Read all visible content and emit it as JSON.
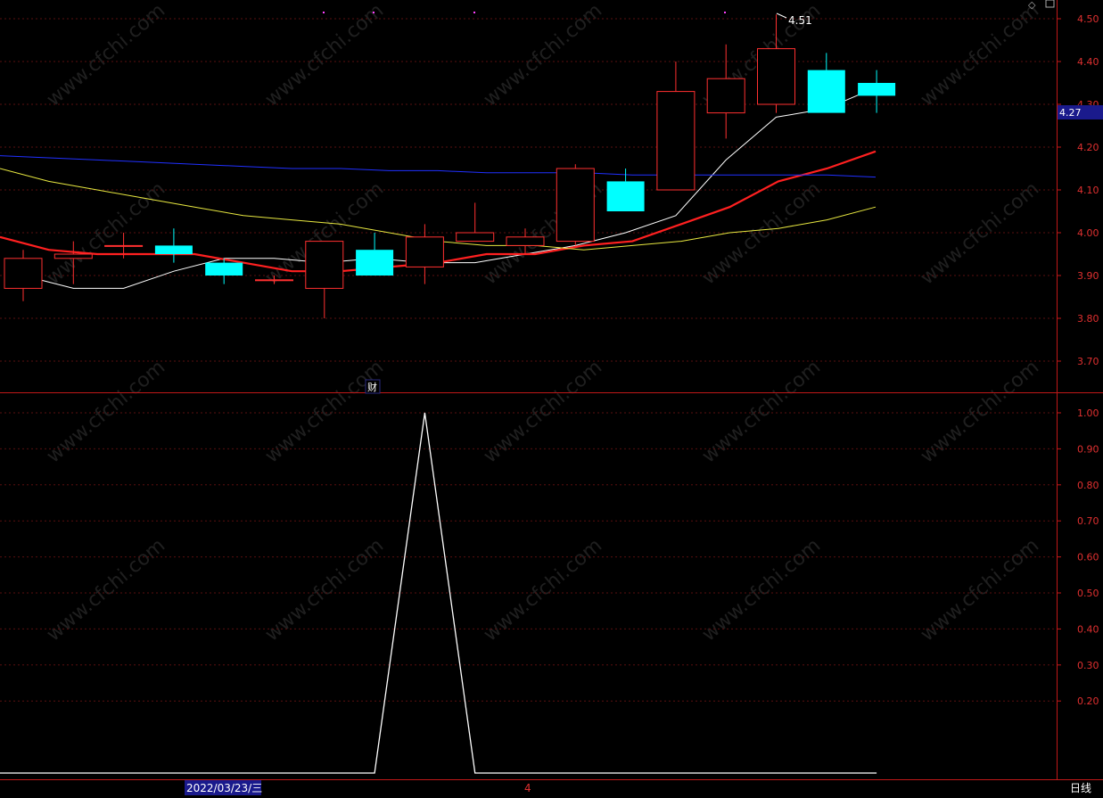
{
  "chart_data": [
    {
      "type": "candlestick",
      "panel": "price",
      "ylim": [
        3.65,
        4.53
      ],
      "y_ticks": [
        "4.50",
        "4.40",
        "4.30",
        "4.20",
        "4.10",
        "4.00",
        "3.90",
        "3.80",
        "3.70"
      ],
      "current_price_label": "4.27",
      "max_label": "4.51",
      "candles": [
        {
          "open": 3.87,
          "close": 3.94,
          "high": 3.96,
          "low": 3.84
        },
        {
          "open": 3.94,
          "close": 3.95,
          "high": 3.98,
          "low": 3.88
        },
        {
          "open": 3.97,
          "close": 3.97,
          "high": 4.0,
          "low": 3.94
        },
        {
          "open": 3.97,
          "close": 3.95,
          "high": 4.01,
          "low": 3.93
        },
        {
          "open": 3.93,
          "close": 3.9,
          "high": 3.94,
          "low": 3.88
        },
        {
          "open": 3.89,
          "close": 3.89,
          "high": 3.9,
          "low": 3.88
        },
        {
          "open": 3.87,
          "close": 3.98,
          "high": 3.98,
          "low": 3.8
        },
        {
          "open": 3.96,
          "close": 3.9,
          "high": 4.0,
          "low": 3.9
        },
        {
          "open": 3.92,
          "close": 3.99,
          "high": 4.02,
          "low": 3.88
        },
        {
          "open": 3.98,
          "close": 4.0,
          "high": 4.07,
          "low": 3.98
        },
        {
          "open": 3.97,
          "close": 3.99,
          "high": 4.01,
          "low": 3.95
        },
        {
          "open": 3.98,
          "close": 4.15,
          "high": 4.16,
          "low": 3.97
        },
        {
          "open": 4.12,
          "close": 4.05,
          "high": 4.15,
          "low": 4.05
        },
        {
          "open": 4.1,
          "close": 4.33,
          "high": 4.4,
          "low": 4.1
        },
        {
          "open": 4.28,
          "close": 4.36,
          "high": 4.44,
          "low": 4.22
        },
        {
          "open": 4.3,
          "close": 4.43,
          "high": 4.51,
          "low": 4.28
        },
        {
          "open": 4.38,
          "close": 4.28,
          "high": 4.42,
          "low": 4.28
        },
        {
          "open": 4.35,
          "close": 4.32,
          "high": 4.38,
          "low": 4.28
        }
      ],
      "series": [
        {
          "color": "#ffffff",
          "values": [
            3.9,
            3.87,
            3.87,
            3.91,
            3.94,
            3.94,
            3.93,
            3.94,
            3.93,
            3.93,
            3.95,
            3.97,
            4.0,
            4.04,
            4.17,
            4.27,
            4.29,
            4.34
          ]
        },
        {
          "color": "#ff2020",
          "values": [
            3.99,
            3.96,
            3.95,
            3.95,
            3.95,
            3.93,
            3.91,
            3.91,
            3.92,
            3.93,
            3.95,
            3.95,
            3.97,
            3.98,
            4.02,
            4.06,
            4.12,
            4.15,
            4.19
          ]
        },
        {
          "color": "#e8e840",
          "values": [
            4.15,
            4.12,
            4.1,
            4.08,
            4.06,
            4.04,
            4.03,
            4.02,
            4.0,
            3.98,
            3.97,
            3.97,
            3.96,
            3.97,
            3.98,
            4.0,
            4.01,
            4.03,
            4.06
          ]
        },
        {
          "color": "#2030ff",
          "values": [
            4.18,
            4.175,
            4.17,
            4.165,
            4.16,
            4.155,
            4.15,
            4.15,
            4.145,
            4.145,
            4.14,
            4.14,
            4.14,
            4.135,
            4.135,
            4.135,
            4.135,
            4.135,
            4.13
          ]
        }
      ]
    },
    {
      "type": "line",
      "panel": "indicator",
      "ylim": [
        0,
        1.02
      ],
      "y_ticks": [
        "1.00",
        "0.90",
        "0.80",
        "0.70",
        "0.60",
        "0.50",
        "0.40",
        "0.30",
        "0.20"
      ],
      "series": [
        {
          "color": "#ffffff",
          "values": [
            0,
            0,
            0,
            0,
            0,
            0,
            0,
            0,
            1,
            0,
            0,
            0,
            0,
            0,
            0,
            0,
            0,
            0
          ]
        }
      ]
    }
  ],
  "marker_label": "财",
  "date_label": "2022/03/23/三",
  "cursor_label": "4",
  "period_label": "日线",
  "watermark": "www.cfchi.com",
  "colors": {
    "up": "#ff3030",
    "down": "#00ffff",
    "axis": "#c01818",
    "grid": "#5a0f0f"
  }
}
